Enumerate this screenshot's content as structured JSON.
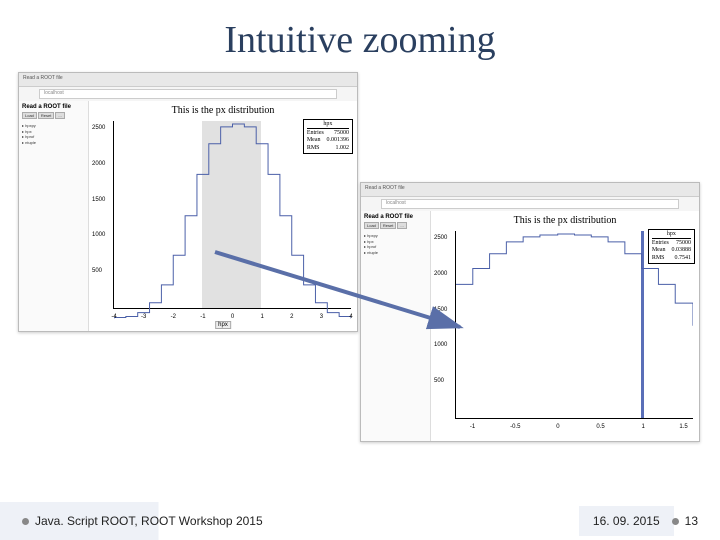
{
  "slide": {
    "title": "Intuitive zooming",
    "footer_left": "Java. Script ROOT, ROOT Workshop 2015",
    "footer_date": "16. 09. 2015",
    "footer_page": "13"
  },
  "browser_left": {
    "tab": "Read a ROOT file",
    "url": "localhost",
    "sidebar_title": "Read a ROOT file",
    "buttons": [
      "Load",
      "Reset",
      "..."
    ],
    "tree": [
      "▸ hpxpy",
      "▸ hpx",
      "▸ hprof",
      "▸ ntuple"
    ],
    "plot_title": "This is the px distribution",
    "xlabel": "hpx",
    "stat": {
      "name": "hpx",
      "entries": "75000",
      "mean": "0.001396",
      "rms": "1.002"
    },
    "yticks": [
      "2500",
      "2000",
      "1500",
      "1000",
      "500"
    ],
    "xticks": [
      "-4",
      "-3",
      "-2",
      "-1",
      "0",
      "1",
      "2",
      "3",
      "4"
    ],
    "selection": {
      "from": "-1",
      "to": "1"
    }
  },
  "browser_right": {
    "tab": "Read a ROOT file",
    "url": "localhost",
    "sidebar_title": "Read a ROOT file",
    "buttons": [
      "Load",
      "Reset",
      "..."
    ],
    "tree": [
      "▸ hpxpy",
      "▸ hpx",
      "▸ hprof",
      "▸ ntuple"
    ],
    "plot_title": "This is the px distribution",
    "stat": {
      "name": "hpx",
      "entries": "75000",
      "mean": "0.03888",
      "rms": "0.7541"
    },
    "yticks": [
      "2500",
      "2000",
      "1500",
      "1000",
      "500"
    ],
    "xticks": [
      "-1",
      "-0.5",
      "0",
      "0.5",
      "1",
      "1.5"
    ],
    "selection_bar_x": "1"
  },
  "chart_data": [
    {
      "type": "bar",
      "title": "This is the px distribution",
      "xlabel": "hpx",
      "ylabel": "",
      "xlim": [
        -4,
        4
      ],
      "ylim": [
        0,
        2600
      ],
      "x": [
        -4.0,
        -3.6,
        -3.2,
        -2.8,
        -2.4,
        -2.0,
        -1.6,
        -1.2,
        -0.8,
        -0.4,
        0.0,
        0.4,
        0.8,
        1.2,
        1.6,
        2.0,
        2.4,
        2.8,
        3.2,
        3.6,
        4.0
      ],
      "values": [
        5,
        25,
        80,
        200,
        440,
        820,
        1350,
        1900,
        2300,
        2520,
        2560,
        2520,
        2300,
        1900,
        1350,
        820,
        440,
        200,
        80,
        25,
        5
      ],
      "stat": {
        "Entries": 75000,
        "Mean": 0.001396,
        "RMS": 1.002
      },
      "selection": {
        "xmin": -1,
        "xmax": 1
      }
    },
    {
      "type": "bar",
      "title": "This is the px distribution",
      "xlabel": "",
      "ylabel": "",
      "xlim": [
        -1.2,
        1.6
      ],
      "ylim": [
        0,
        2600
      ],
      "x": [
        -1.2,
        -1.0,
        -0.8,
        -0.6,
        -0.4,
        -0.2,
        0.0,
        0.2,
        0.4,
        0.6,
        0.8,
        1.0,
        1.2,
        1.4,
        1.6
      ],
      "values": [
        1900,
        2100,
        2300,
        2450,
        2520,
        2555,
        2560,
        2555,
        2520,
        2450,
        2300,
        2100,
        1900,
        1650,
        1350
      ],
      "stat": {
        "Entries": 75000,
        "Mean": 0.03888,
        "RMS": 0.7541
      }
    }
  ]
}
